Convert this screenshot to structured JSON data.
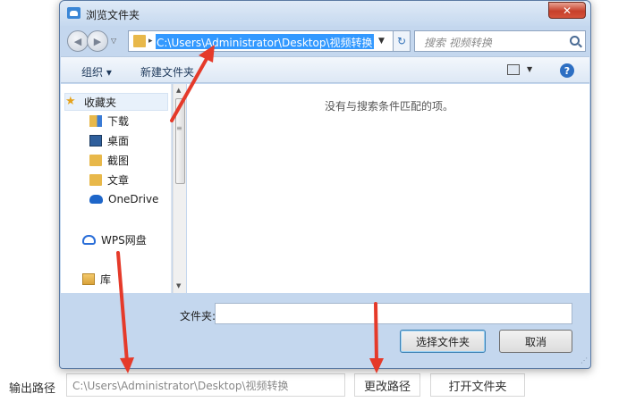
{
  "dialog": {
    "title": "浏览文件夹",
    "close_label": "✕",
    "address_path": "C:\\Users\\Administrator\\Desktop\\视频转换",
    "search_placeholder": "搜索 视频转换",
    "toolbar": {
      "organize": "组织 ▾",
      "new_folder": "新建文件夹"
    },
    "nav_items": [
      {
        "label": "收藏夹",
        "icon": "star-icon"
      },
      {
        "label": "下载",
        "icon": "download-folder-icon"
      },
      {
        "label": "桌面",
        "icon": "desktop-icon"
      },
      {
        "label": "截图",
        "icon": "folder-icon"
      },
      {
        "label": "文章",
        "icon": "folder-icon"
      },
      {
        "label": "OneDrive",
        "icon": "onedrive-icon"
      },
      {
        "label": "WPS网盘",
        "icon": "cloud-icon"
      },
      {
        "label": "库",
        "icon": "library-icon"
      }
    ],
    "empty_message": "没有与搜索条件匹配的项。",
    "folder_label": "文件夹:",
    "folder_value": "",
    "select_button": "选择文件夹",
    "cancel_button": "取消"
  },
  "bottom_bar": {
    "output_label": "输出路径",
    "output_value": "C:\\Users\\Administrator\\Desktop\\视频转换",
    "change_path_button": "更改路径",
    "open_folder_button": "打开文件夹"
  },
  "colors": {
    "annotation_arrow": "#e53a2a",
    "selection": "#3399ff"
  }
}
